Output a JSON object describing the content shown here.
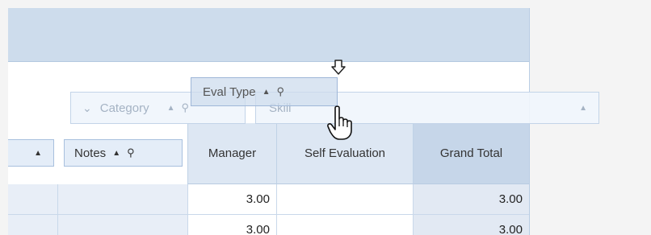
{
  "drop_area": {
    "category_label": "Category",
    "skill_label": "Skill",
    "chevron_glyph": "⌄",
    "sort_up_glyph": "▲",
    "pin_glyph": "⚲"
  },
  "dragging_field": {
    "label": "Eval Type"
  },
  "row_header": {
    "notes_label": "Notes"
  },
  "columns": {
    "manager": "Manager",
    "self_evaluation": "Self Evaluation",
    "grand_total": "Grand Total"
  },
  "rows": [
    {
      "manager": "3.00",
      "self_evaluation": "",
      "grand_total": "3.00"
    },
    {
      "manager": "3.00",
      "self_evaluation": "",
      "grand_total": "3.00"
    }
  ],
  "colors": {
    "header_bg": "#cddcec",
    "button_bg": "#e4edf8",
    "border": "#a8c0de",
    "grand_total_bg": "#c6d6e9"
  }
}
